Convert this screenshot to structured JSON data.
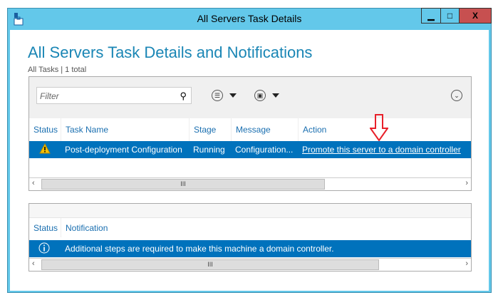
{
  "window": {
    "title": "All Servers Task Details",
    "minimize": "▁",
    "maximize": "□",
    "close": "X"
  },
  "page": {
    "title": "All Servers Task Details and Notifications",
    "subtitle": "All Tasks | 1 total"
  },
  "tasks": {
    "filter_placeholder": "Filter",
    "columns": [
      "Status",
      "Task Name",
      "Stage",
      "Message",
      "Action"
    ],
    "rows": [
      {
        "status": "warning",
        "task_name": "Post-deployment Configuration",
        "stage": "Running",
        "message": "Configuration...",
        "action": "Promote this server to a domain controller"
      }
    ]
  },
  "notifications": {
    "columns": [
      "Status",
      "Notification"
    ],
    "rows": [
      {
        "status": "info",
        "text": "Additional steps are required to make this machine a domain controller."
      }
    ]
  },
  "scroll_thumb": "III",
  "colors": {
    "titlebar": "#63c8ea",
    "selected": "#0072bc",
    "close": "#c75050",
    "annotation": "#e8202a"
  }
}
